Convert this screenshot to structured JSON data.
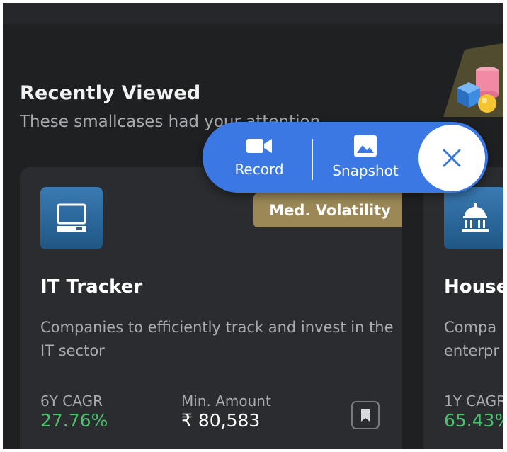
{
  "section": {
    "title": "Recently Viewed",
    "subtitle": "These smallcases had your attention"
  },
  "cards": [
    {
      "name": "IT Tracker",
      "badge": "Med. Volatility",
      "description": "Companies to efficiently track and invest in the IT sector",
      "stat1_label": "6Y CAGR",
      "stat1_value": "27.76%",
      "stat2_label": "Min. Amount",
      "stat2_value": "₹ 80,583",
      "icon": "computer-icon"
    },
    {
      "name": "House",
      "description": "Compa\nenterpr",
      "stat1_label": "1Y CAGR",
      "stat1_value": "65.43%",
      "icon": "bank-building-icon"
    }
  ],
  "recorder": {
    "record_label": "Record",
    "snapshot_label": "Snapshot",
    "close_icon": "close-icon"
  },
  "colors": {
    "background": "#1f2022",
    "card": "#2b2c2f",
    "accent_blue": "#3b78e4",
    "badge_gold": "#9b8856",
    "positive_green": "#4cc26f"
  }
}
